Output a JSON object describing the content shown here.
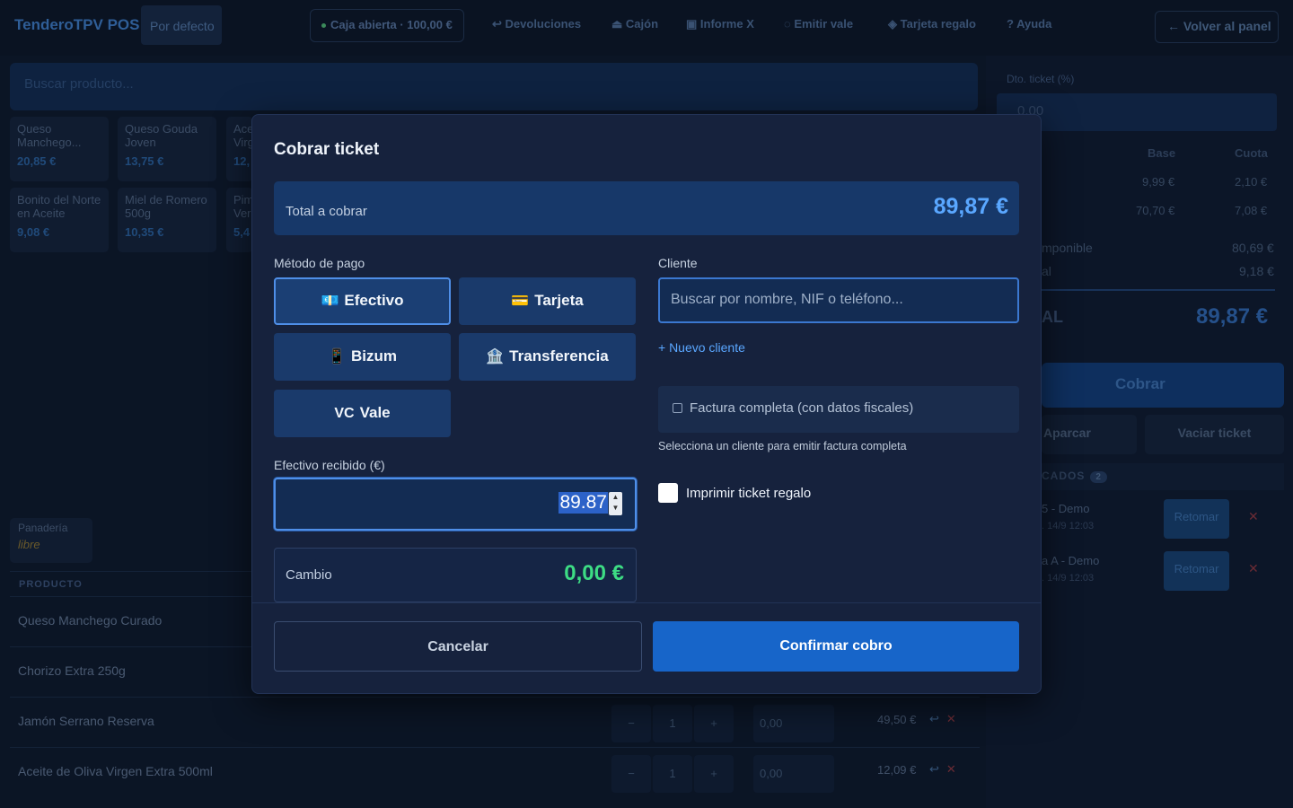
{
  "topbar": {
    "brand": "TenderoTPV POS",
    "profile": "Por defecto",
    "cash_status": "Caja abierta · 100,00 €",
    "nav": [
      {
        "icon": "↩",
        "label": "Devoluciones"
      },
      {
        "icon": "⏏",
        "label": "Cajón"
      },
      {
        "icon": "▣",
        "label": "Informe X"
      },
      {
        "icon": "◌",
        "label": "Emitir vale"
      },
      {
        "icon": "◈",
        "label": "Tarjeta regalo"
      },
      {
        "icon": "?",
        "label": "Ayuda"
      }
    ],
    "back_label": "← Volver al panel"
  },
  "catalog": {
    "search_placeholder": "Buscar producto...",
    "products": [
      {
        "name": "Queso Manchego...",
        "price": "20,85 €"
      },
      {
        "name": "Queso Gouda Joven",
        "price": "13,75 €"
      },
      {
        "name": "Ace Virg",
        "price": "12,"
      },
      {
        "name": "Bonito del Norte en Aceite",
        "price": "9,08 €"
      },
      {
        "name": "Miel de Romero 500g",
        "price": "10,35 €"
      },
      {
        "name": "Pim Ver",
        "price": "5,4"
      }
    ],
    "category": {
      "name": "Panadería",
      "tag": "libre"
    }
  },
  "ticket_lines": {
    "header": "PRODUCTO",
    "rows": [
      {
        "name": "Queso Manchego Curado"
      },
      {
        "name": "Chorizo Extra 250g"
      },
      {
        "name": "Jamón Serrano Reserva",
        "qty": "1",
        "minus": "−",
        "plus": "+",
        "discount": "0,00",
        "price": "49,50 €"
      },
      {
        "name": "Aceite de Oliva Virgen Extra 500ml",
        "qty": "1",
        "minus": "−",
        "plus": "+",
        "discount": "0,00",
        "price": "12,09 €"
      }
    ],
    "return_icon": "↩",
    "remove_icon": "✕"
  },
  "summary": {
    "dto_label": "Dto. ticket (%)",
    "dto_value": "0,00",
    "col_base": "Base",
    "col_cuota": "Cuota",
    "taxes": [
      {
        "base": "9,99 €",
        "cuota": "2,10 €"
      },
      {
        "base": "70,70 €",
        "cuota": "7,08 €"
      }
    ],
    "base_label": "mponible",
    "base_value": "80,69 €",
    "iva_label": "al",
    "iva_value": "9,18 €",
    "total_label": "AL",
    "total_value": "89,87 €",
    "cobrar": "Cobrar",
    "aparcar": "Aparcar",
    "vaciar": "Vaciar ticket",
    "parked_title": "CADOS",
    "parked_count": "2",
    "parked": [
      {
        "name": "5 - Demo",
        "meta": ". 14/9 12:03",
        "action": "Retomar"
      },
      {
        "name": "a A - Demo",
        "meta": ". 14/9 12:03",
        "action": "Retomar"
      }
    ]
  },
  "modal": {
    "title": "Cobrar ticket",
    "total_label": "Total a cobrar",
    "total_value": "89,87 €",
    "payment_label": "Método de pago",
    "methods": [
      {
        "icon": "💶",
        "label": "Efectivo",
        "active": true
      },
      {
        "icon": "💳",
        "label": "Tarjeta"
      },
      {
        "icon": "📱",
        "label": "Bizum"
      },
      {
        "icon": "🏦",
        "label": "Transferencia"
      },
      {
        "icon": "VC",
        "label": "Vale"
      }
    ],
    "cash_label": "Efectivo recibido (€)",
    "cash_value": "89.87",
    "change_label": "Cambio",
    "change_value": "0,00 €",
    "client_label": "Cliente",
    "client_placeholder": "Buscar por nombre, NIF o teléfono...",
    "new_client": "+ Nuevo cliente",
    "invoice_label": "Factura completa (con datos fiscales)",
    "invoice_hint": "Selecciona un cliente para emitir factura completa",
    "gift_label": "Imprimir ticket regalo",
    "cancel": "Cancelar",
    "confirm": "Confirmar cobro"
  },
  "colors": {
    "accent": "#1765c9",
    "total_highlight": "#5aa7ff",
    "change_positive": "#3ddc84",
    "modal_bg": "#16223d"
  }
}
